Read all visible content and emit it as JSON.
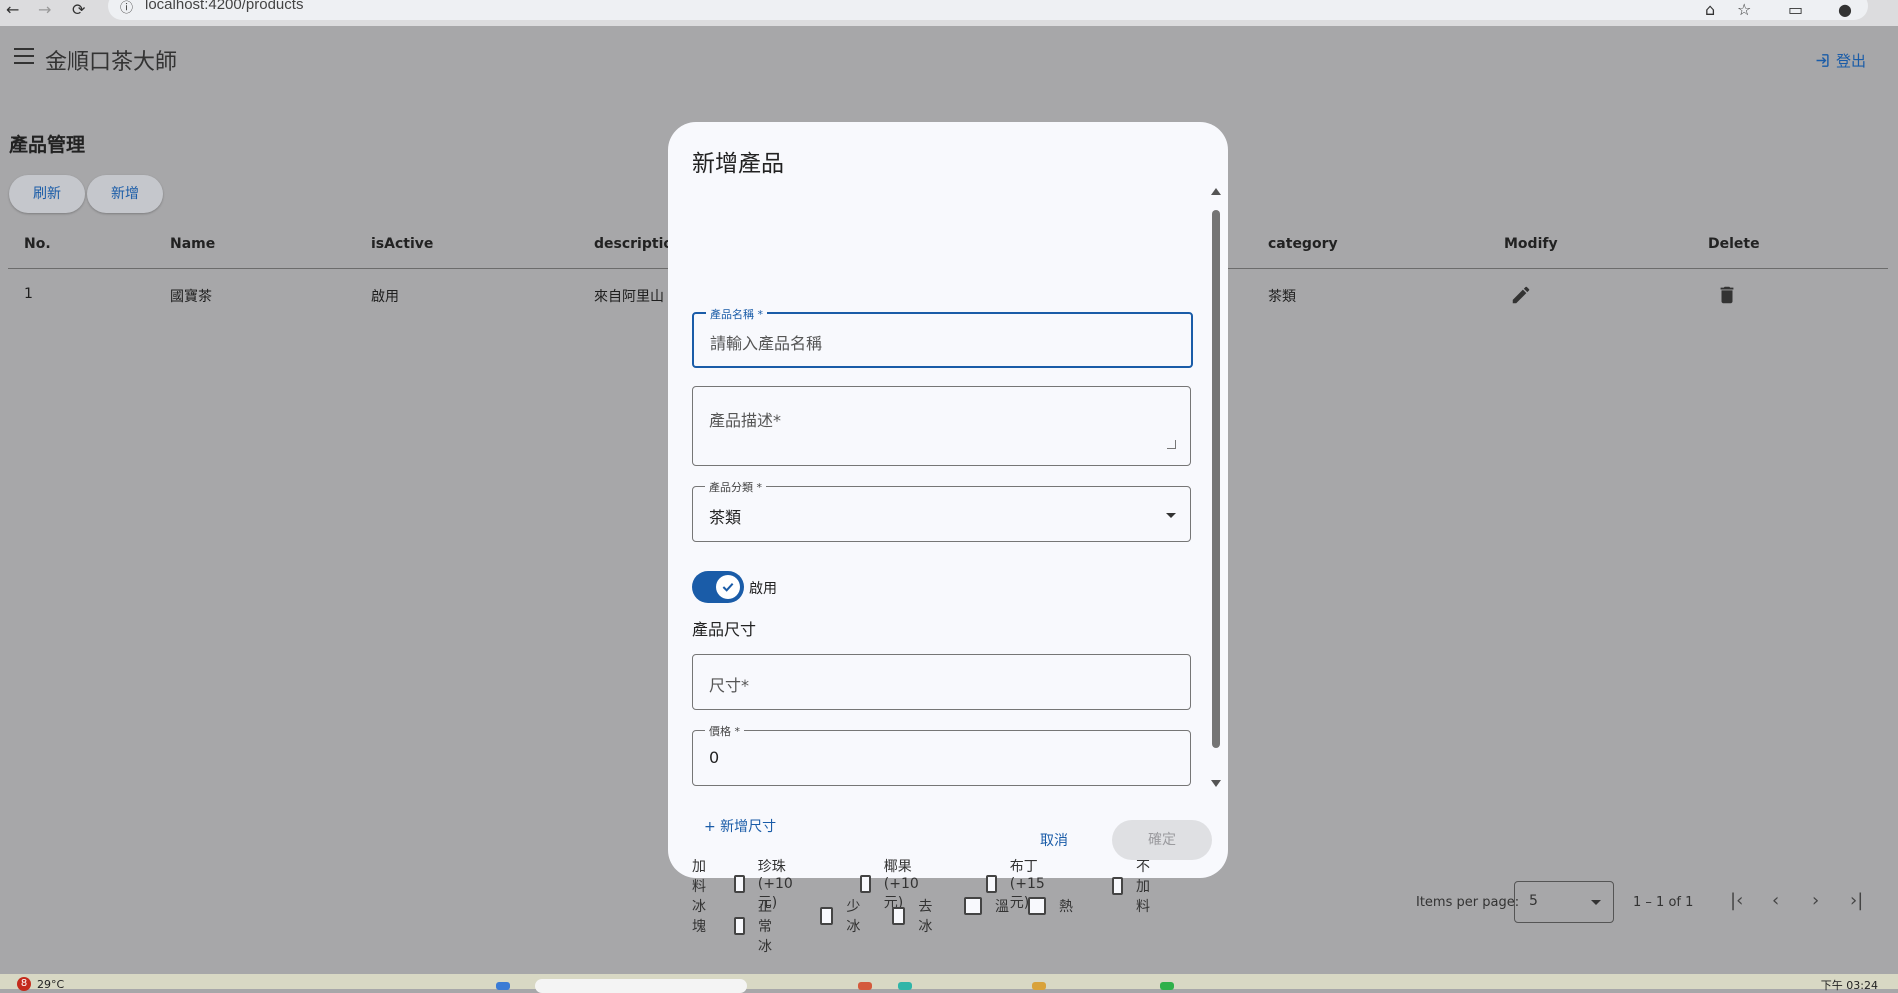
{
  "browser": {
    "url": "localhost:4200/products",
    "back_icon": "arrow-left-icon",
    "forward_icon": "arrow-right-icon",
    "reload_icon": "reload-icon"
  },
  "header": {
    "title": "金順口茶大師",
    "logout_label": "登出"
  },
  "page": {
    "title": "產品管理",
    "refresh_label": "刷新",
    "add_label": "新增"
  },
  "table": {
    "headers": {
      "no": "No.",
      "name": "Name",
      "is_active": "isActive",
      "description": "description",
      "category": "category",
      "modify": "Modify",
      "delete": "Delete"
    },
    "rows": [
      {
        "no": "1",
        "name": "國寶茶",
        "is_active": "啟用",
        "description": "來自阿里山",
        "category": "茶類"
      }
    ]
  },
  "paginator": {
    "items_per_page_label": "Items per page:",
    "page_size": "5",
    "range": "1 – 1 of 1"
  },
  "dialog": {
    "title": "新增產品",
    "name_field": {
      "label": "產品名稱 *",
      "placeholder": "請輸入產品名稱"
    },
    "description_field": {
      "placeholder": "產品描述*"
    },
    "category_field": {
      "label": "產品分類 *",
      "value": "茶類"
    },
    "active_toggle_label": "啟用",
    "size_section_label": "產品尺寸",
    "size_field": {
      "placeholder": "尺寸*"
    },
    "price_field": {
      "label": "價格 *",
      "value": "0"
    },
    "add_size_label": "+ 新增尺寸",
    "toppings": {
      "label": "加料",
      "options": [
        "珍珠 (+10元)",
        "椰果 (+10元)",
        "布丁 (+15元)",
        "不加料"
      ]
    },
    "ice": {
      "label": "冰塊",
      "options": [
        "正常冰",
        "少冰",
        "去冰",
        "溫",
        "熱"
      ]
    },
    "cancel_label": "取消",
    "confirm_label": "確定"
  },
  "taskbar": {
    "notification_count": "8",
    "temperature": "29°C",
    "time": "下午 03:24"
  },
  "colors": {
    "primary": "#1a5ca8",
    "backdrop": "#a7a7a9",
    "dialog_bg": "#f8f9fd"
  }
}
